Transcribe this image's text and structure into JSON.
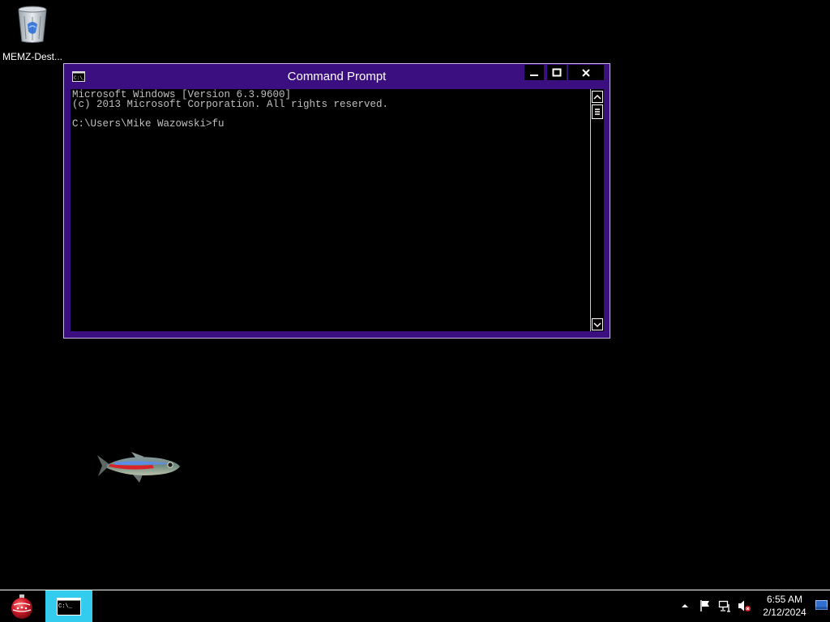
{
  "desktop": {
    "icons": [
      {
        "label": "MEMZ-Dest...",
        "icon": "recycle-bin-icon"
      }
    ]
  },
  "window": {
    "title": "Command Prompt",
    "icon": "console-icon",
    "controls": {
      "minimize": "minimize-icon",
      "maximize": "maximize-icon",
      "close": "close-icon"
    },
    "console_lines": [
      "Microsoft Windows [Version 6.3.9600]",
      "(c) 2013 Microsoft Corporation. All rights reserved.",
      "",
      "C:\\Users\\Mike Wazowski>fu"
    ],
    "colors": {
      "frame": "#3b0f80",
      "text": "#c0c0c0"
    }
  },
  "taskbar": {
    "start_icon": "start-orb-icon",
    "task_buttons": [
      {
        "label": "C:\\_",
        "icon": "console-icon",
        "active": true
      }
    ],
    "tray_icons": [
      "tray-chevron-up-icon",
      "action-center-flag-icon",
      "network-icon",
      "volume-muted-icon"
    ],
    "clock": {
      "time": "6:55 AM",
      "date": "2/12/2024"
    },
    "active_color": "#33ccee"
  }
}
